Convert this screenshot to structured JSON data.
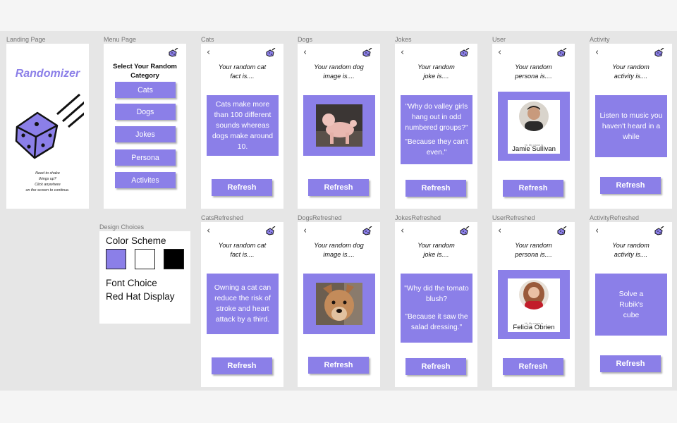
{
  "labels": {
    "landing": "Landing Page",
    "menu": "Menu Page",
    "cats": "Cats",
    "dogs": "Dogs",
    "jokes": "Jokes",
    "user": "User",
    "activity": "Activity",
    "design": "Design Choices",
    "cats_refreshed": "CatsRefreshed",
    "dogs_refreshed": "DogsRefreshed",
    "jokes_refreshed": "JokesRefreshed",
    "user_refreshed": "UserRefreshed",
    "activity_refreshed": "ActivityRefreshed"
  },
  "landing": {
    "title": "Randomizer",
    "hint_1": "Need to shake",
    "hint_2": "things up?",
    "hint_3": "Click anywhere",
    "hint_4": "on the screen to continue.",
    "icon": "tumbling-dice-icon"
  },
  "menu": {
    "heading_1": "Select Your Random",
    "heading_2": "Category",
    "items": [
      "Cats",
      "Dogs",
      "Jokes",
      "Persona",
      "Activites"
    ]
  },
  "common": {
    "refresh": "Refresh",
    "back_icon": "chevron-left-icon",
    "dice_icon": "dice-icon"
  },
  "cats": {
    "prompt_1": "Your random cat",
    "prompt_2": "fact is....",
    "fact": "Cats make more than 100 different sounds whereas dogs make around 10."
  },
  "dogs": {
    "prompt_1": "Your random dog",
    "prompt_2": "image is...."
  },
  "jokes": {
    "prompt_1": "Your random",
    "prompt_2": "joke is....",
    "setup": "\"Why do valley girls hang out in odd numbered groups?\"",
    "punchline": "\"Because they can't even.\""
  },
  "user": {
    "prompt_1": "Your random",
    "prompt_2": "persona is....",
    "greeting": "Hi, My name is",
    "name": "Jamie Sullivan"
  },
  "activity": {
    "prompt_1": "Your random",
    "prompt_2": "activity is....",
    "text": "Listen to music you haven't heard in a while"
  },
  "cats_r": {
    "prompt_1": "Your random cat",
    "prompt_2": "fact is....",
    "fact": "Owning a cat can reduce the risk of stroke and heart attack by a third."
  },
  "dogs_r": {
    "prompt_1": "Your random dog",
    "prompt_2": "image is...."
  },
  "jokes_r": {
    "prompt_1": "Your random",
    "prompt_2": "joke is....",
    "setup": "\"Why did the tomato blush?",
    "punchline": "\"Because it saw the salad dressing.\""
  },
  "user_r": {
    "prompt_1": "Your random",
    "prompt_2": "persona is....",
    "greeting": "Hi, My name is",
    "name": "Felicia Obrien"
  },
  "activity_r": {
    "prompt_1": "Your random",
    "prompt_2": "activity is....",
    "text": "Solve a Rubik's cube"
  },
  "design": {
    "color_heading": "Color Scheme",
    "swatches": [
      "#8b7fe8",
      "#ffffff",
      "#000000"
    ],
    "font_heading": "Font Choice",
    "font_name": "Red Hat Display"
  },
  "colors": {
    "accent": "#8b7fe8",
    "canvas": "#e6e6e6"
  }
}
